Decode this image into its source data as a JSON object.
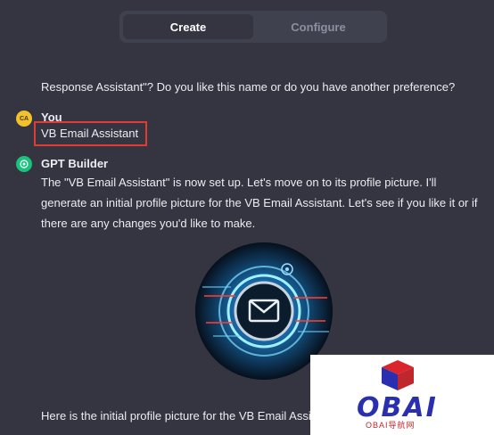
{
  "tabs": [
    {
      "label": "Create",
      "active": true
    },
    {
      "label": "Configure",
      "active": false
    }
  ],
  "messages": {
    "prev_text": "Response Assistant\"? Do you like this name or do you have another preference?",
    "user": {
      "avatar_initials": "CA",
      "name": "You",
      "text": "VB Email Assistant"
    },
    "gpt": {
      "name": "GPT Builder",
      "text": "The \"VB Email Assistant\" is now set up. Let's move on to its profile picture. I'll generate an initial profile picture for the VB Email Assistant. Let's see if you like it or if there are any changes you'd like to make.",
      "followup": "Here is the initial profile picture for the VB Email Assistant"
    }
  },
  "watermark": {
    "brand": "OBAI",
    "tagline": "OBAI导航网"
  },
  "colors": {
    "background": "#343541",
    "highlight": "#e23b32",
    "user_avatar": "#f2c12e",
    "gpt_avatar": "#19c37d"
  }
}
